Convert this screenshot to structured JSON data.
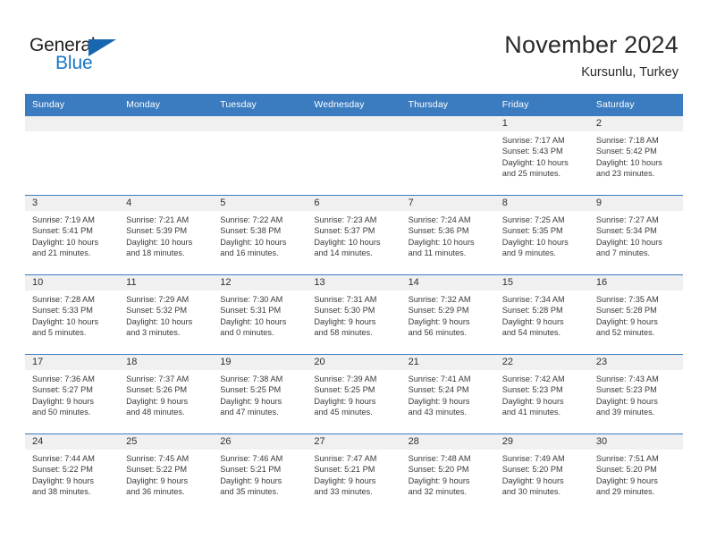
{
  "brand": {
    "name_part1": "General",
    "name_part2": "Blue",
    "accent_color": "#1a76c4"
  },
  "header": {
    "title": "November 2024",
    "location": "Kursunlu, Turkey"
  },
  "calendar": {
    "header_bg": "#3b7cc0",
    "weekday_headers": [
      "Sunday",
      "Monday",
      "Tuesday",
      "Wednesday",
      "Thursday",
      "Friday",
      "Saturday"
    ],
    "weeks": [
      [
        {
          "day": "",
          "sunrise": "",
          "sunset": "",
          "daylight1": "",
          "daylight2": ""
        },
        {
          "day": "",
          "sunrise": "",
          "sunset": "",
          "daylight1": "",
          "daylight2": ""
        },
        {
          "day": "",
          "sunrise": "",
          "sunset": "",
          "daylight1": "",
          "daylight2": ""
        },
        {
          "day": "",
          "sunrise": "",
          "sunset": "",
          "daylight1": "",
          "daylight2": ""
        },
        {
          "day": "",
          "sunrise": "",
          "sunset": "",
          "daylight1": "",
          "daylight2": ""
        },
        {
          "day": "1",
          "sunrise": "Sunrise: 7:17 AM",
          "sunset": "Sunset: 5:43 PM",
          "daylight1": "Daylight: 10 hours",
          "daylight2": "and 25 minutes."
        },
        {
          "day": "2",
          "sunrise": "Sunrise: 7:18 AM",
          "sunset": "Sunset: 5:42 PM",
          "daylight1": "Daylight: 10 hours",
          "daylight2": "and 23 minutes."
        }
      ],
      [
        {
          "day": "3",
          "sunrise": "Sunrise: 7:19 AM",
          "sunset": "Sunset: 5:41 PM",
          "daylight1": "Daylight: 10 hours",
          "daylight2": "and 21 minutes."
        },
        {
          "day": "4",
          "sunrise": "Sunrise: 7:21 AM",
          "sunset": "Sunset: 5:39 PM",
          "daylight1": "Daylight: 10 hours",
          "daylight2": "and 18 minutes."
        },
        {
          "day": "5",
          "sunrise": "Sunrise: 7:22 AM",
          "sunset": "Sunset: 5:38 PM",
          "daylight1": "Daylight: 10 hours",
          "daylight2": "and 16 minutes."
        },
        {
          "day": "6",
          "sunrise": "Sunrise: 7:23 AM",
          "sunset": "Sunset: 5:37 PM",
          "daylight1": "Daylight: 10 hours",
          "daylight2": "and 14 minutes."
        },
        {
          "day": "7",
          "sunrise": "Sunrise: 7:24 AM",
          "sunset": "Sunset: 5:36 PM",
          "daylight1": "Daylight: 10 hours",
          "daylight2": "and 11 minutes."
        },
        {
          "day": "8",
          "sunrise": "Sunrise: 7:25 AM",
          "sunset": "Sunset: 5:35 PM",
          "daylight1": "Daylight: 10 hours",
          "daylight2": "and 9 minutes."
        },
        {
          "day": "9",
          "sunrise": "Sunrise: 7:27 AM",
          "sunset": "Sunset: 5:34 PM",
          "daylight1": "Daylight: 10 hours",
          "daylight2": "and 7 minutes."
        }
      ],
      [
        {
          "day": "10",
          "sunrise": "Sunrise: 7:28 AM",
          "sunset": "Sunset: 5:33 PM",
          "daylight1": "Daylight: 10 hours",
          "daylight2": "and 5 minutes."
        },
        {
          "day": "11",
          "sunrise": "Sunrise: 7:29 AM",
          "sunset": "Sunset: 5:32 PM",
          "daylight1": "Daylight: 10 hours",
          "daylight2": "and 3 minutes."
        },
        {
          "day": "12",
          "sunrise": "Sunrise: 7:30 AM",
          "sunset": "Sunset: 5:31 PM",
          "daylight1": "Daylight: 10 hours",
          "daylight2": "and 0 minutes."
        },
        {
          "day": "13",
          "sunrise": "Sunrise: 7:31 AM",
          "sunset": "Sunset: 5:30 PM",
          "daylight1": "Daylight: 9 hours",
          "daylight2": "and 58 minutes."
        },
        {
          "day": "14",
          "sunrise": "Sunrise: 7:32 AM",
          "sunset": "Sunset: 5:29 PM",
          "daylight1": "Daylight: 9 hours",
          "daylight2": "and 56 minutes."
        },
        {
          "day": "15",
          "sunrise": "Sunrise: 7:34 AM",
          "sunset": "Sunset: 5:28 PM",
          "daylight1": "Daylight: 9 hours",
          "daylight2": "and 54 minutes."
        },
        {
          "day": "16",
          "sunrise": "Sunrise: 7:35 AM",
          "sunset": "Sunset: 5:28 PM",
          "daylight1": "Daylight: 9 hours",
          "daylight2": "and 52 minutes."
        }
      ],
      [
        {
          "day": "17",
          "sunrise": "Sunrise: 7:36 AM",
          "sunset": "Sunset: 5:27 PM",
          "daylight1": "Daylight: 9 hours",
          "daylight2": "and 50 minutes."
        },
        {
          "day": "18",
          "sunrise": "Sunrise: 7:37 AM",
          "sunset": "Sunset: 5:26 PM",
          "daylight1": "Daylight: 9 hours",
          "daylight2": "and 48 minutes."
        },
        {
          "day": "19",
          "sunrise": "Sunrise: 7:38 AM",
          "sunset": "Sunset: 5:25 PM",
          "daylight1": "Daylight: 9 hours",
          "daylight2": "and 47 minutes."
        },
        {
          "day": "20",
          "sunrise": "Sunrise: 7:39 AM",
          "sunset": "Sunset: 5:25 PM",
          "daylight1": "Daylight: 9 hours",
          "daylight2": "and 45 minutes."
        },
        {
          "day": "21",
          "sunrise": "Sunrise: 7:41 AM",
          "sunset": "Sunset: 5:24 PM",
          "daylight1": "Daylight: 9 hours",
          "daylight2": "and 43 minutes."
        },
        {
          "day": "22",
          "sunrise": "Sunrise: 7:42 AM",
          "sunset": "Sunset: 5:23 PM",
          "daylight1": "Daylight: 9 hours",
          "daylight2": "and 41 minutes."
        },
        {
          "day": "23",
          "sunrise": "Sunrise: 7:43 AM",
          "sunset": "Sunset: 5:23 PM",
          "daylight1": "Daylight: 9 hours",
          "daylight2": "and 39 minutes."
        }
      ],
      [
        {
          "day": "24",
          "sunrise": "Sunrise: 7:44 AM",
          "sunset": "Sunset: 5:22 PM",
          "daylight1": "Daylight: 9 hours",
          "daylight2": "and 38 minutes."
        },
        {
          "day": "25",
          "sunrise": "Sunrise: 7:45 AM",
          "sunset": "Sunset: 5:22 PM",
          "daylight1": "Daylight: 9 hours",
          "daylight2": "and 36 minutes."
        },
        {
          "day": "26",
          "sunrise": "Sunrise: 7:46 AM",
          "sunset": "Sunset: 5:21 PM",
          "daylight1": "Daylight: 9 hours",
          "daylight2": "and 35 minutes."
        },
        {
          "day": "27",
          "sunrise": "Sunrise: 7:47 AM",
          "sunset": "Sunset: 5:21 PM",
          "daylight1": "Daylight: 9 hours",
          "daylight2": "and 33 minutes."
        },
        {
          "day": "28",
          "sunrise": "Sunrise: 7:48 AM",
          "sunset": "Sunset: 5:20 PM",
          "daylight1": "Daylight: 9 hours",
          "daylight2": "and 32 minutes."
        },
        {
          "day": "29",
          "sunrise": "Sunrise: 7:49 AM",
          "sunset": "Sunset: 5:20 PM",
          "daylight1": "Daylight: 9 hours",
          "daylight2": "and 30 minutes."
        },
        {
          "day": "30",
          "sunrise": "Sunrise: 7:51 AM",
          "sunset": "Sunset: 5:20 PM",
          "daylight1": "Daylight: 9 hours",
          "daylight2": "and 29 minutes."
        }
      ]
    ]
  }
}
